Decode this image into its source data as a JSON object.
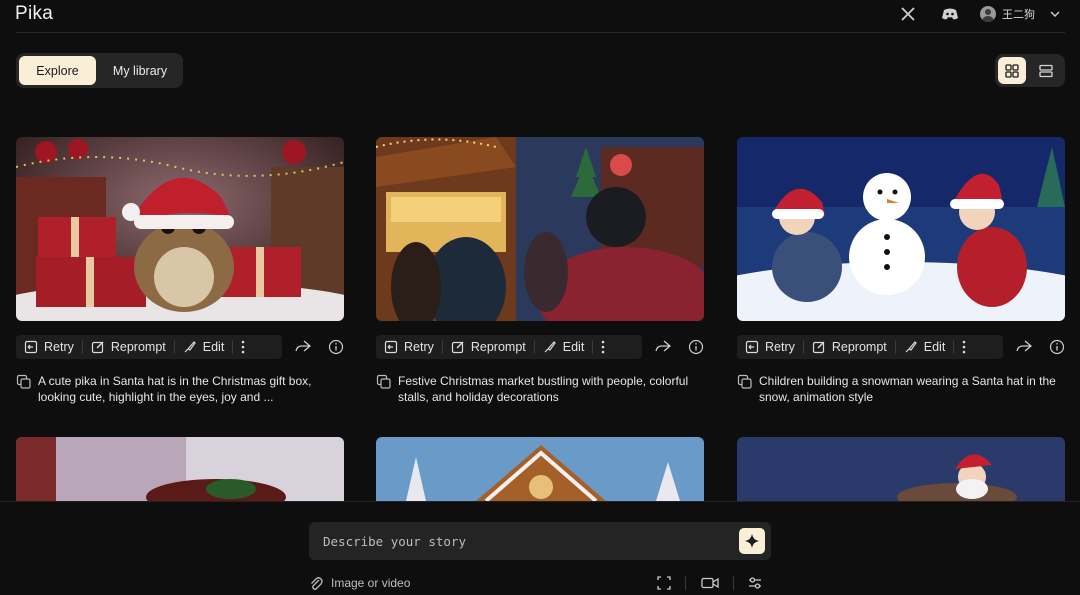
{
  "app": {
    "logo": "Pika"
  },
  "header": {
    "user_name": "王二狗"
  },
  "tabs": [
    {
      "label": "Explore",
      "active": true
    },
    {
      "label": "My library",
      "active": false
    }
  ],
  "view_toggle": {
    "active": "grid"
  },
  "actions": {
    "retry": "Retry",
    "reprompt": "Reprompt",
    "edit": "Edit"
  },
  "cards": [
    {
      "caption": "A cute pika in Santa hat is in the Christmas gift box, looking cute, highlight in the eyes, joy and ..."
    },
    {
      "caption": "Festive Christmas market bustling with people, colorful stalls, and holiday decorations"
    },
    {
      "caption": "Children building a snowman wearing a Santa hat in the snow, animation style"
    }
  ],
  "composer": {
    "placeholder": "Describe your story",
    "attach_label": "Image or video"
  },
  "colors": {
    "accent": "#fbeed6",
    "background": "#0e0e0e",
    "panel": "#262626"
  }
}
